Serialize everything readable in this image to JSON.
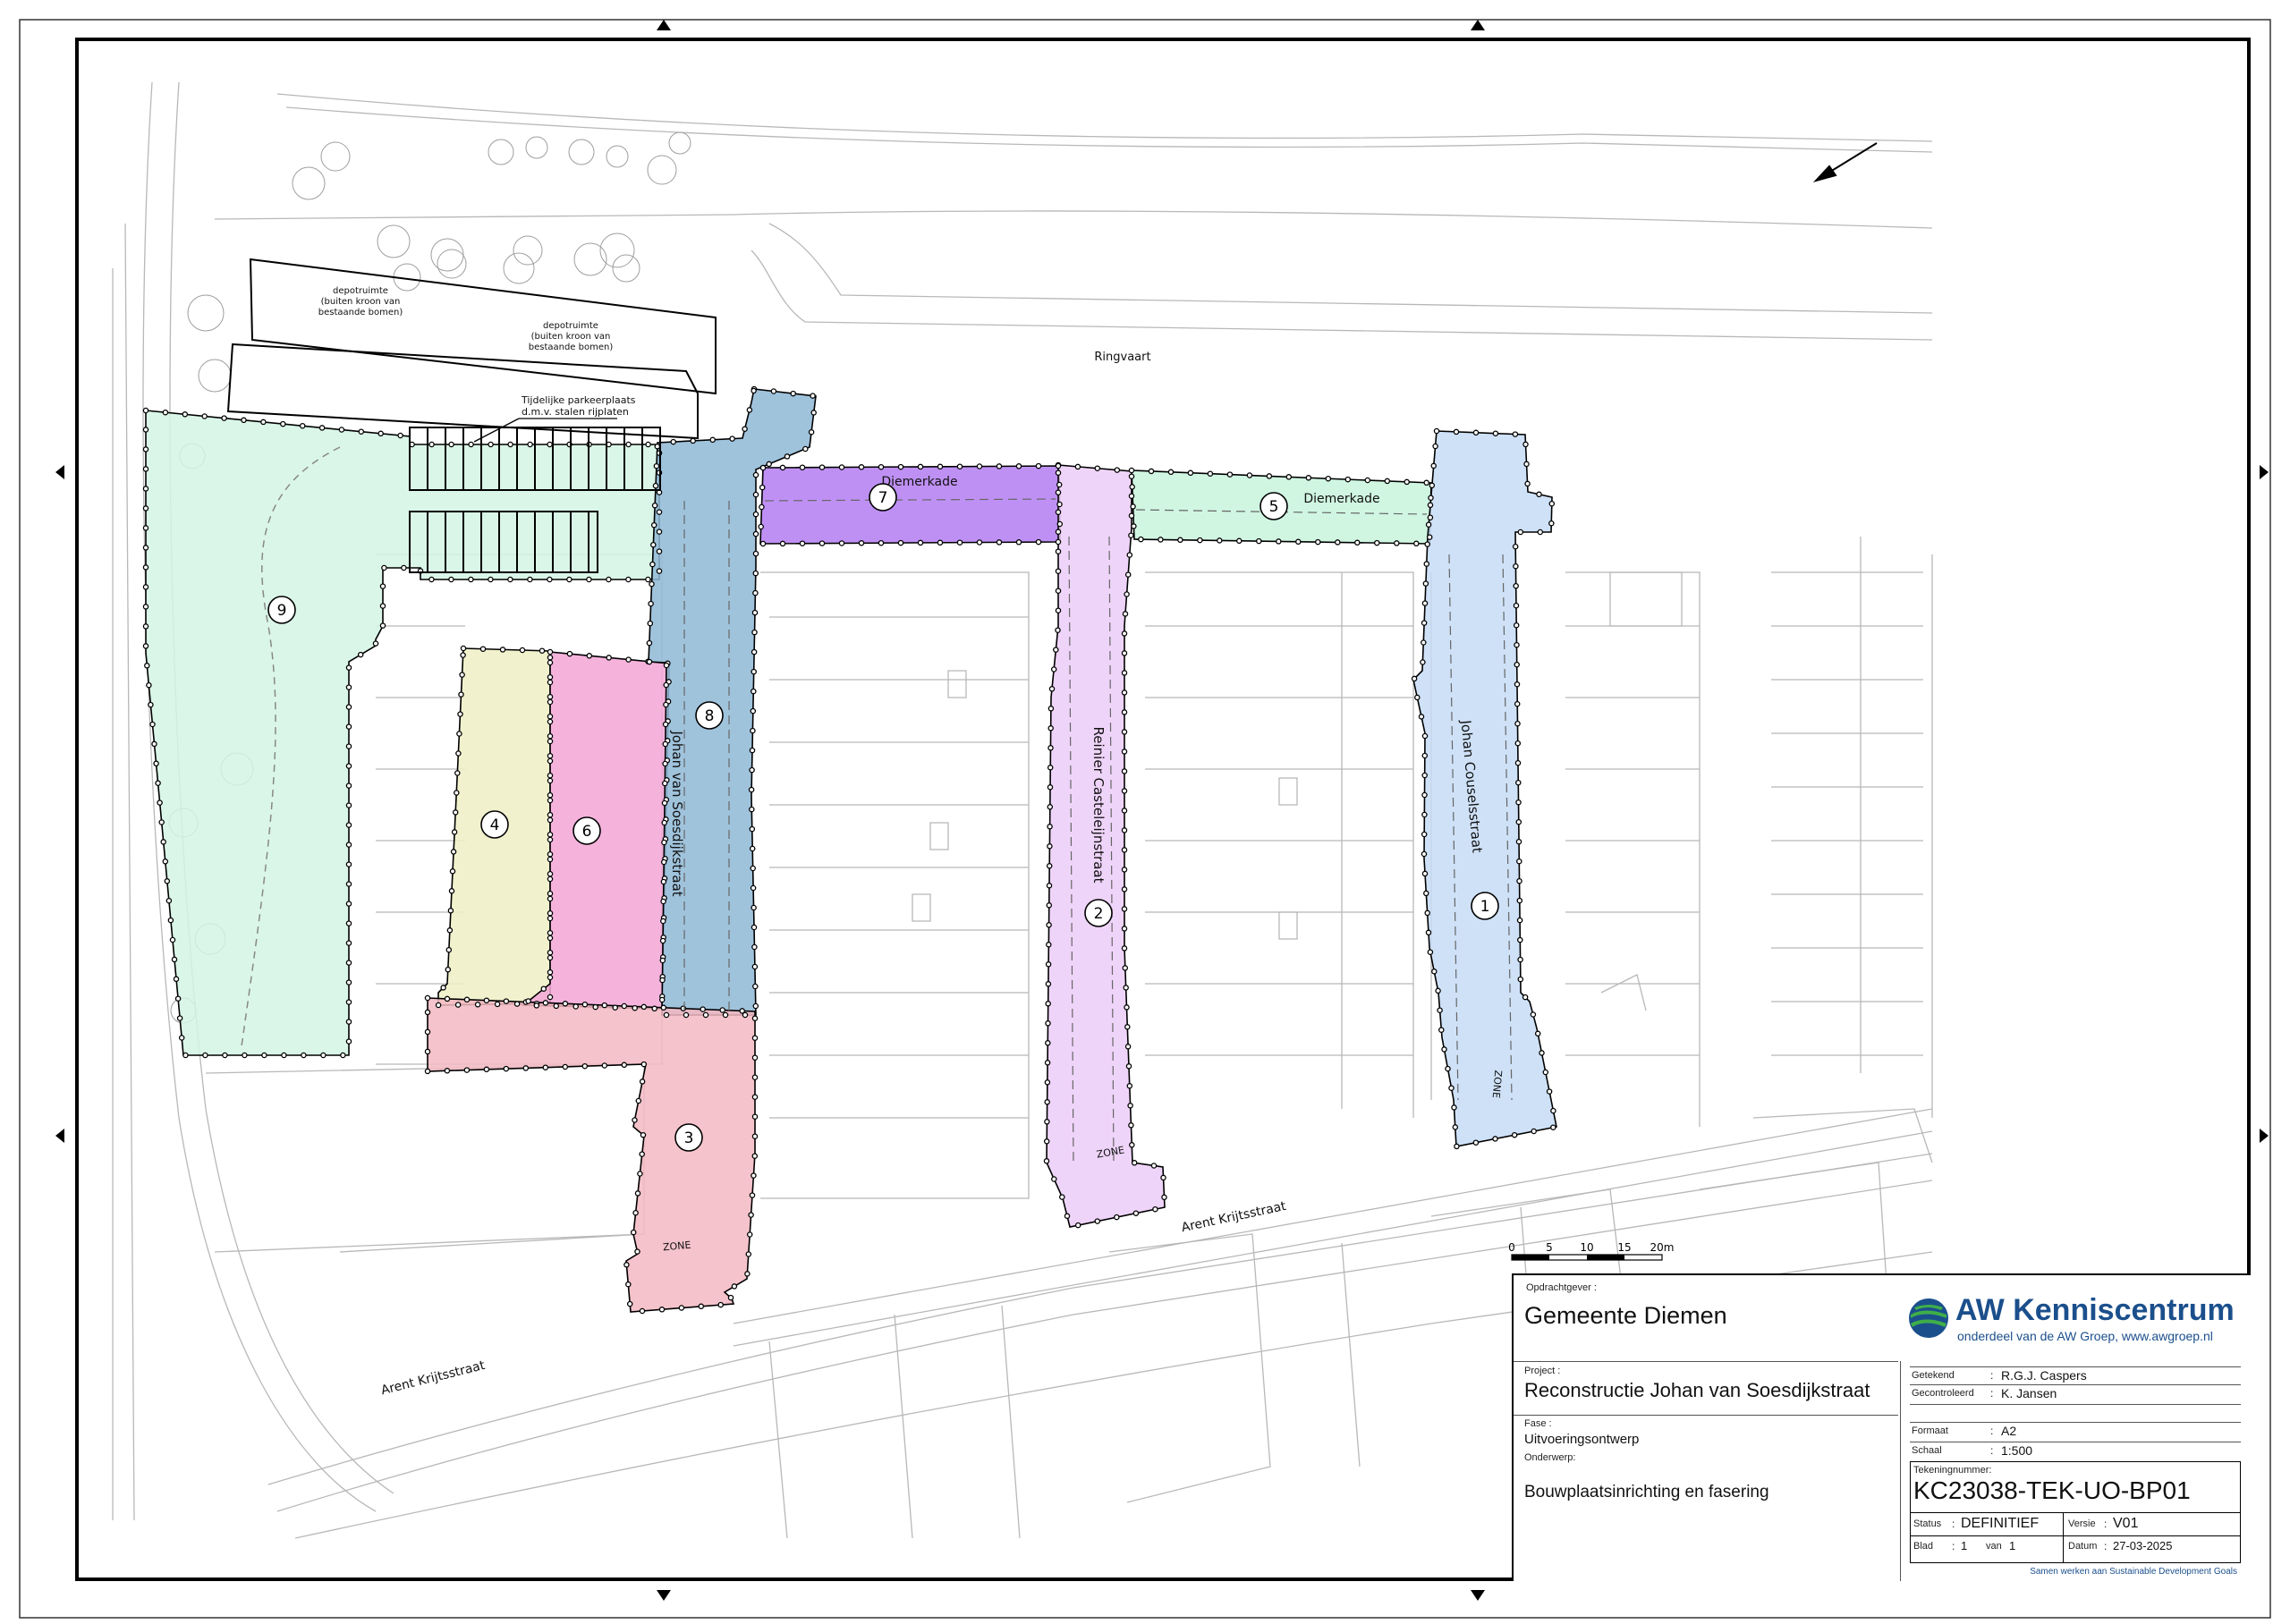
{
  "map": {
    "labels": {
      "ringvaart": "Ringvaart",
      "depot_1": [
        "depotruimte",
        "(buiten kroon van",
        "bestaande bomen)"
      ],
      "depot_2": [
        "depotruimte",
        "(buiten kroon van",
        "bestaande bomen)"
      ],
      "parking": [
        "Tijdelijke parkeerplaats",
        "d.m.v. stalen rijplaten"
      ],
      "diemerkade_west": "Diemerkade",
      "diemerkade_east": "Diemerkade",
      "street_soesdijk": "Johan van Soesdijkstraat",
      "street_casteleijn": "Reinier Casteleijnstraat",
      "street_cousels": "Johan Couselsstraat",
      "arent_1": "Arent Krijtsstraat",
      "arent_2": "Arent Krijtsstraat",
      "zone_1": "ZONE",
      "zone_2": "ZONE",
      "zone_3": "ZONE"
    },
    "phases": [
      "1",
      "2",
      "3",
      "4",
      "5",
      "6",
      "7",
      "8",
      "9"
    ],
    "phase_colors": {
      "1": "#c6dcf6",
      "2": "#eccdf8",
      "3": "#f3b9c2",
      "4": "#eef0c4",
      "5": "#c8f5dd",
      "6": "#f3a6d6",
      "7": "#b47cf2",
      "8": "#8fb9d6",
      "9": "#d4f5e4"
    },
    "scale_bar": [
      "0",
      "5",
      "10",
      "15",
      "20m"
    ]
  },
  "title_block": {
    "client_label": "Opdrachtgever :",
    "client": "Gemeente Diemen",
    "brand": "AW Kenniscentrum",
    "brand_sub": "onderdeel van de AW Groep, www.awgroep.nl",
    "brand_color": "#1b4f8c",
    "project_label": "Project :",
    "project": "Reconstructie Johan van Soesdijkstraat",
    "getekend_label": "Getekend",
    "getekend": "R.G.J. Caspers",
    "gecontroleerd_label": "Gecontroleerd",
    "gecontroleerd": "K. Jansen",
    "fase_label": "Fase :",
    "fase": "Uitvoeringsontwerp",
    "formaat_label": "Formaat",
    "formaat": "A2",
    "schaal_label": "Schaal",
    "schaal": "1:500",
    "onderwerp_label": "Onderwerp:",
    "onderwerp": "Bouwplaatsinrichting en fasering",
    "tekeningnummer_label": "Tekeningnummer:",
    "tekeningnummer": "KC23038-TEK-UO-BP01",
    "status_label": "Status",
    "status": "DEFINITIEF",
    "versie_label": "Versie",
    "versie": "V01",
    "blad_label": "Blad",
    "blad": "1",
    "van_label": "van",
    "van": "1",
    "datum_label": "Datum",
    "datum": "27-03-2025",
    "footer": "Samen werken aan Sustainable Development Goals"
  }
}
